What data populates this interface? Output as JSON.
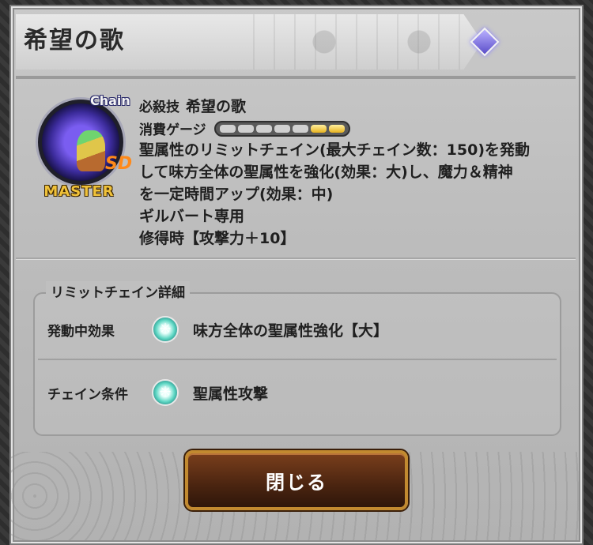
{
  "dialog": {
    "title": "希望の歌"
  },
  "skill": {
    "chain_badge": "Chain",
    "master_label": "MASTER",
    "kind_label": "必殺技",
    "name": "希望の歌",
    "gauge_label": "消費ゲージ",
    "gauge_total_segments": 7,
    "gauge_filled_segments": 2,
    "description_lines": [
      "聖属性のリミットチェイン(最大チェイン数：150)を発動",
      "して味方全体の聖属性を強化(効果：大)し、魔力＆精神",
      "を一定時間アップ(効果：中)",
      "ギルバート専用",
      "修得時【攻撃力＋10】"
    ]
  },
  "limit_chain": {
    "section_title": "リミットチェイン詳細",
    "rows": [
      {
        "label": "発動中効果",
        "value": "味方全体の聖属性強化【大】"
      },
      {
        "label": "チェイン条件",
        "value": "聖属性攻撃"
      }
    ]
  },
  "footer": {
    "close_label": "閉じる"
  },
  "colors": {
    "gauge_fill": "#e7b21e",
    "button_border": "#c28a30",
    "crystal": "#5fd7c4",
    "title_jewel": "#5b4ec9"
  }
}
